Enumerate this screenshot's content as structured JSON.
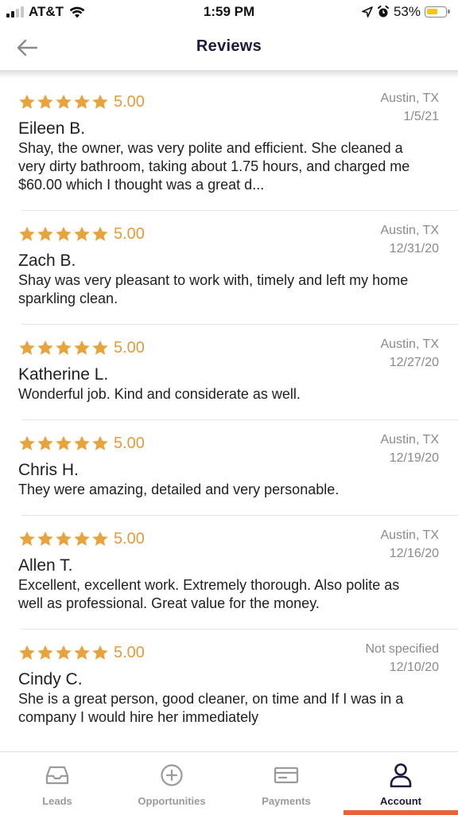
{
  "status_bar": {
    "carrier": "AT&T",
    "time": "1:59 PM",
    "battery": "53%"
  },
  "header": {
    "title": "Reviews"
  },
  "reviews": [
    {
      "rating": 5.0,
      "rating_text": "5.00",
      "name": "Eileen B.",
      "location": "Austin, TX",
      "date": "1/5/21",
      "text": "Shay, the owner, was very polite and efficient. She cleaned a very dirty bathroom, taking about 1.75 hours, and charged me $60.00 which I thought was a great d..."
    },
    {
      "rating": 5.0,
      "rating_text": "5.00",
      "name": "Zach B.",
      "location": "Austin, TX",
      "date": "12/31/20",
      "text": "Shay was very pleasant to work with, timely and left my home sparkling clean."
    },
    {
      "rating": 5.0,
      "rating_text": "5.00",
      "name": "Katherine L.",
      "location": "Austin, TX",
      "date": "12/27/20",
      "text": "Wonderful job. Kind and considerate as well."
    },
    {
      "rating": 5.0,
      "rating_text": "5.00",
      "name": "Chris H.",
      "location": "Austin, TX",
      "date": "12/19/20",
      "text": "They were amazing, detailed and very personable."
    },
    {
      "rating": 5.0,
      "rating_text": "5.00",
      "name": "Allen T.",
      "location": "Austin, TX",
      "date": "12/16/20",
      "text": "Excellent, excellent work. Extremely thorough. Also polite as well as professional. Great value for the money."
    },
    {
      "rating": 5.0,
      "rating_text": "5.00",
      "name": "Cindy C.",
      "location": "Not specified",
      "date": "12/10/20",
      "text": "She is a great person, good cleaner, on time and If I was in a company I would hire her immediately"
    }
  ],
  "tabs": [
    {
      "label": "Leads",
      "icon": "inbox-icon"
    },
    {
      "label": "Opportunities",
      "icon": "plus-circle-icon"
    },
    {
      "label": "Payments",
      "icon": "card-icon"
    },
    {
      "label": "Account",
      "icon": "person-icon",
      "active": true
    }
  ],
  "colors": {
    "star": "#e8a33d",
    "rating_text": "#e39b3c",
    "title": "#1c1a3f",
    "active_indicator": "#e8603c"
  }
}
